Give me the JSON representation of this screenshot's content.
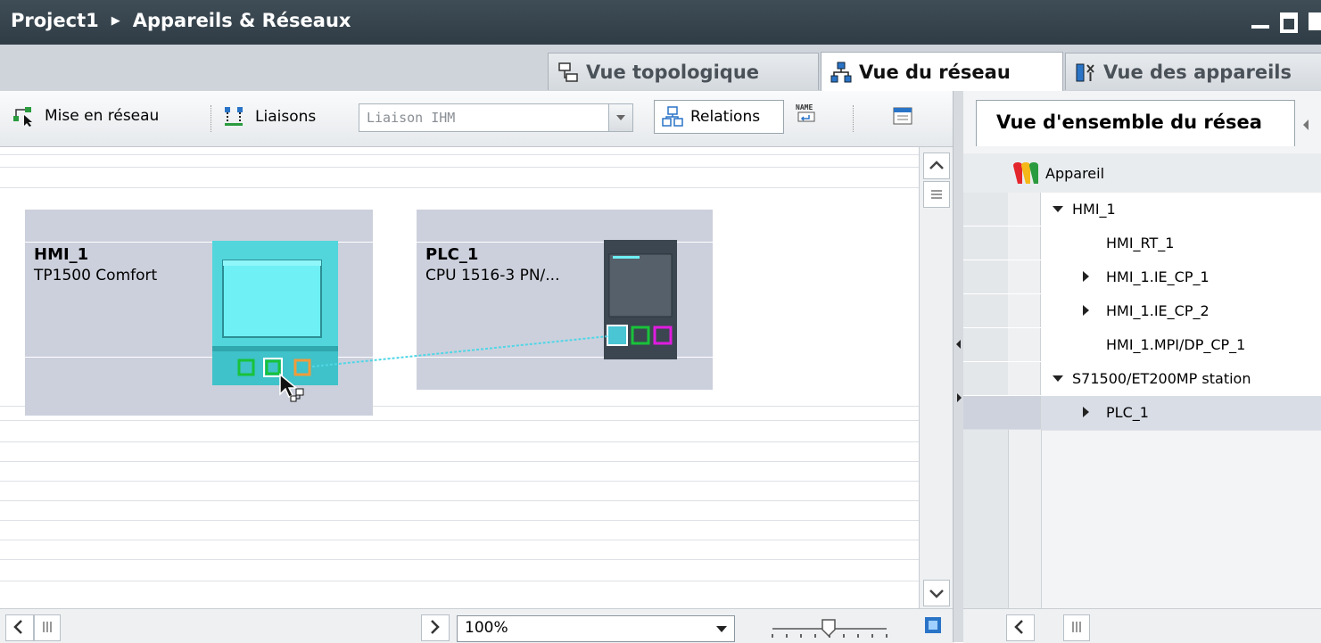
{
  "titlebar": {
    "project": "Project1",
    "page": "Appareils & Réseaux"
  },
  "tabs": [
    {
      "label": "Vue topologique",
      "icon": "topology-icon",
      "active": false
    },
    {
      "label": "Vue du réseau",
      "icon": "network-icon",
      "active": true
    },
    {
      "label": "Vue des appareils",
      "icon": "devices-icon",
      "active": false
    }
  ],
  "toolbar": {
    "network_label": "Mise en réseau",
    "connections_label": "Liaisons",
    "connection_type": "Liaison IHM",
    "relations_label": "Relations"
  },
  "devices": [
    {
      "name": "HMI_1",
      "type": "TP1500 Comfort"
    },
    {
      "name": "PLC_1",
      "type": "CPU 1516-3 PN/..."
    }
  ],
  "zoom": {
    "value": "100%"
  },
  "overview": {
    "tab_label": "Vue d'ensemble du résea",
    "column_header": "Appareil",
    "rows": [
      {
        "label": "HMI_1",
        "expander": "down"
      },
      {
        "label": "HMI_RT_1",
        "expander": "none"
      },
      {
        "label": "HMI_1.IE_CP_1",
        "expander": "right"
      },
      {
        "label": "HMI_1.IE_CP_2",
        "expander": "right"
      },
      {
        "label": "HMI_1.MPI/DP_CP_1",
        "expander": "none"
      },
      {
        "label": "S71500/ET200MP station",
        "expander": "down"
      },
      {
        "label": "PLC_1",
        "expander": "right"
      }
    ]
  },
  "colors": {
    "titlebar": "#34424c",
    "device_box": "#ccd0dc",
    "hmi_screen": "#6ff0f4",
    "link_line": "#4fd6e6"
  }
}
